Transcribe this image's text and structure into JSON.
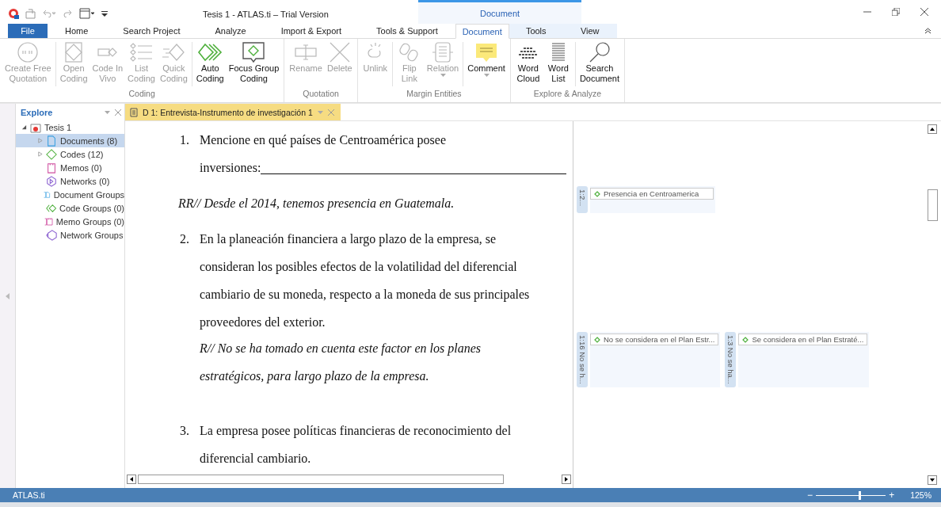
{
  "window": {
    "title": "Tesis 1 - ATLAS.ti – Trial Version"
  },
  "context_tab_group": {
    "label": "Document"
  },
  "tabs": [
    {
      "label": "File",
      "kind": "file",
      "selected": false
    },
    {
      "label": "Home",
      "kind": "tab",
      "selected": false
    },
    {
      "label": "Search Project",
      "kind": "tab",
      "selected": false
    },
    {
      "label": "Analyze",
      "kind": "tab",
      "selected": false
    },
    {
      "label": "Import & Export",
      "kind": "tab",
      "selected": false
    },
    {
      "label": "Tools & Support",
      "kind": "tab",
      "selected": false
    },
    {
      "label": "Document",
      "kind": "context",
      "selected": true
    },
    {
      "label": "Tools",
      "kind": "context",
      "selected": false
    },
    {
      "label": "View",
      "kind": "context",
      "selected": false
    }
  ],
  "ribbon_groups": [
    {
      "label": "Coding",
      "buttons": [
        {
          "label": [
            "Create Free",
            "Quotation"
          ],
          "kind": "quote",
          "disabled": true,
          "separator_after": true
        },
        {
          "label": [
            "Open",
            "Coding"
          ],
          "kind": "open",
          "disabled": true
        },
        {
          "label": [
            "Code In",
            "Vivo"
          ],
          "kind": "vivo",
          "disabled": true
        },
        {
          "label": [
            "List",
            "Coding"
          ],
          "kind": "list",
          "disabled": true
        },
        {
          "label": [
            "Quick",
            "Coding"
          ],
          "kind": "quick",
          "disabled": true,
          "separator_after": true
        },
        {
          "label": [
            "Auto",
            "Coding"
          ],
          "kind": "auto",
          "disabled": false
        },
        {
          "label": [
            "Focus Group",
            "Coding"
          ],
          "kind": "focus",
          "disabled": false
        }
      ]
    },
    {
      "label": "Quotation",
      "buttons": [
        {
          "label": [
            "Rename"
          ],
          "kind": "rename",
          "disabled": true
        },
        {
          "label": [
            "Delete"
          ],
          "kind": "delete",
          "disabled": true
        }
      ]
    },
    {
      "label": "Margin Entities",
      "buttons": [
        {
          "label": [
            "Unlink"
          ],
          "kind": "unlink",
          "disabled": true,
          "separator_after": true
        },
        {
          "label": [
            "Flip",
            "Link"
          ],
          "kind": "flip",
          "disabled": true
        },
        {
          "label": [
            "Relation"
          ],
          "kind": "relation",
          "disabled": true,
          "dropdown": true,
          "separator_after": true
        },
        {
          "label": [
            "Comment"
          ],
          "kind": "comment",
          "disabled": false,
          "dropdown": true
        }
      ]
    },
    {
      "label": "Explore & Analyze",
      "buttons": [
        {
          "label": [
            "Word",
            "Cloud"
          ],
          "kind": "cloud",
          "disabled": false
        },
        {
          "label": [
            "Word",
            "List"
          ],
          "kind": "wordlist",
          "disabled": false,
          "separator_after": true
        },
        {
          "label": [
            "Search",
            "Document"
          ],
          "kind": "search",
          "disabled": false
        }
      ]
    }
  ],
  "explorer": {
    "title": "Explore",
    "root": {
      "label": "Tesis 1",
      "expanded": true,
      "children": [
        {
          "label": "Documents (8)",
          "kind": "document",
          "expandable": true,
          "selected": true
        },
        {
          "label": "Codes (12)",
          "kind": "code",
          "expandable": true,
          "selected": false
        },
        {
          "label": "Memos (0)",
          "kind": "memo",
          "expandable": false,
          "selected": false
        },
        {
          "label": "Networks (0)",
          "kind": "network",
          "expandable": false,
          "selected": false
        },
        {
          "label": "Document Groups",
          "kind": "document-group",
          "expandable": false,
          "selected": false
        },
        {
          "label": "Code Groups (0)",
          "kind": "code-group",
          "expandable": false,
          "selected": false
        },
        {
          "label": "Memo Groups (0)",
          "kind": "memo-group",
          "expandable": false,
          "selected": false
        },
        {
          "label": "Network Groups",
          "kind": "network-group",
          "expandable": false,
          "selected": false
        }
      ]
    }
  },
  "document_tab": {
    "label": "D 1: Entrevista-Instrumento de investigación 1"
  },
  "document": [
    {
      "kind": "question",
      "number": "1.",
      "lines": [
        "Mencione en qué países de Centroamérica posee",
        "inversiones:"
      ],
      "fill_line": true
    },
    {
      "kind": "answer",
      "lines": [
        "RR// Desde el 2014, tenemos presencia en Guatemala."
      ],
      "indented": false
    },
    {
      "kind": "question",
      "number": "2.",
      "lines": [
        "En la planeación financiera a largo plazo de la empresa, se",
        "consideran los posibles efectos de la volatilidad del diferencial",
        "cambiario de su moneda, respecto a la moneda de sus principales",
        "proveedores del exterior."
      ]
    },
    {
      "kind": "answer",
      "lines": [
        "R// No se ha tomado en cuenta este factor en los planes",
        "estratégicos, para largo plazo de la empresa."
      ],
      "indented": true
    },
    {
      "kind": "question",
      "number": "3.",
      "lines": [
        "La empresa posee políticas financieras de reconocimiento del",
        "diferencial cambiario."
      ]
    }
  ],
  "margin_rows": [
    [
      {
        "quotation": "1:2...",
        "code": "Presencia en Centroamerica"
      }
    ],
    [
      {
        "quotation": "1:16 No se h...",
        "code": "No se considera en el Plan Estr..."
      },
      {
        "quotation": "1:3 No se ha...",
        "code": "Se considera en el Plan Estraté..."
      }
    ]
  ],
  "status_bar": {
    "text": "ATLAS.ti",
    "zoom": {
      "minus": "−",
      "plus": "+",
      "level": 0.62,
      "reading": "125%"
    }
  }
}
